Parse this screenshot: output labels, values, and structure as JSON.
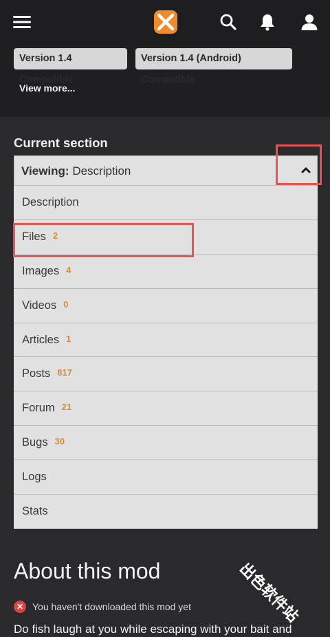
{
  "header": {
    "menu_icon": "hamburger-menu-icon",
    "logo": "nexus-mods-logo",
    "search_icon": "search-icon",
    "notifications_icon": "bell-icon",
    "account_icon": "user-icon"
  },
  "tags": [
    {
      "label": "Version 1.4 Compatible"
    },
    {
      "label": "Version 1.4 (Android) Compatible"
    }
  ],
  "view_more": "View more...",
  "section": {
    "title": "Current section",
    "viewing_label": "Viewing:",
    "viewing_value": "Description",
    "toggle_icon": "chevron-up-icon"
  },
  "menu": [
    {
      "label": "Description",
      "count": ""
    },
    {
      "label": "Files",
      "count": "2"
    },
    {
      "label": "Images",
      "count": "4"
    },
    {
      "label": "Videos",
      "count": "0"
    },
    {
      "label": "Articles",
      "count": "1"
    },
    {
      "label": "Posts",
      "count": "817"
    },
    {
      "label": "Forum",
      "count": "21"
    },
    {
      "label": "Bugs",
      "count": "30"
    },
    {
      "label": "Logs",
      "count": ""
    },
    {
      "label": "Stats",
      "count": ""
    }
  ],
  "about": {
    "title": "About this mod",
    "status": "You haven't downloaded this mod yet",
    "description": "Do fish laugh at you while escaping with your bait and"
  },
  "watermark": "出色软件站",
  "colors": {
    "accent_count": "#d98b3a",
    "highlight_box": "#e85454",
    "logo_orange": "#f18a2a"
  }
}
